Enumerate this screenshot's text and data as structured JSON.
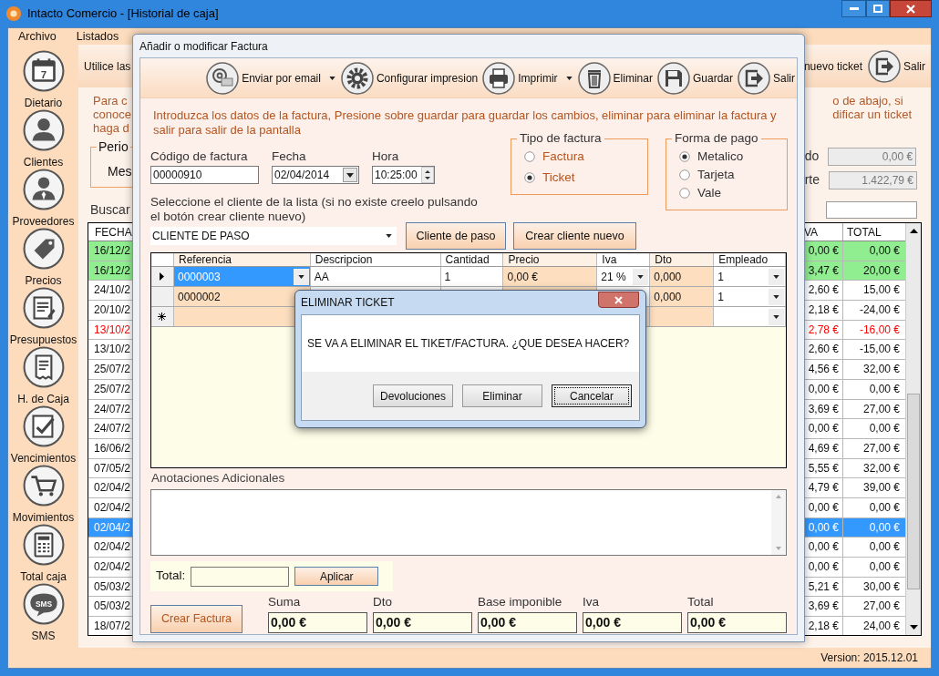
{
  "window": {
    "title": "Intacto Comercio - [Historial de caja]"
  },
  "menu": [
    "Archivo",
    "Listados"
  ],
  "sidebar": {
    "items": [
      {
        "label": "Dietario",
        "icon_text": "7"
      },
      {
        "label": "Clientes"
      },
      {
        "label": "Proveedores"
      },
      {
        "label": "Precios"
      },
      {
        "label": "Presupuestos"
      },
      {
        "label": "H. de Caja"
      },
      {
        "label": "Vencimientos"
      },
      {
        "label": "Movimientos"
      },
      {
        "label": "Total caja"
      },
      {
        "label": "SMS",
        "icon_text": "SMS"
      }
    ]
  },
  "main": {
    "hint": "Utilice las",
    "toolbar": [
      {
        "label": "nuevo ticket"
      },
      {
        "label": "Salir"
      }
    ],
    "help_left": [
      "Para c",
      "conoce",
      "haga d"
    ],
    "help_right": [
      "o de abajo, si",
      "dificar un ticket"
    ],
    "periodo": {
      "legend": "Perio",
      "value": "Mes"
    },
    "totals": [
      {
        "label": "do",
        "value": "0,00 €"
      },
      {
        "label": "rte",
        "value": "1.422,79 €"
      }
    ],
    "search_label": "Buscar",
    "table": {
      "columns": [
        "FECHA",
        "VA",
        "TOTAL"
      ],
      "rows": [
        {
          "fecha": "16/12/2",
          "iva": "0,00 €",
          "total": "0,00 €",
          "highlighted": true,
          "flagged": false,
          "selected": false
        },
        {
          "fecha": "16/12/2",
          "iva": "3,47 €",
          "total": "20,00 €",
          "highlighted": true,
          "flagged": false,
          "selected": false
        },
        {
          "fecha": "24/10/2",
          "iva": "2,60 €",
          "total": "15,00 €",
          "highlighted": false,
          "flagged": false,
          "selected": false
        },
        {
          "fecha": "20/10/2",
          "iva": "2,18 €",
          "total": "-24,00 €",
          "highlighted": false,
          "flagged": false,
          "selected": false
        },
        {
          "fecha": "13/10/2",
          "iva": "2,78 €",
          "total": "-16,00 €",
          "highlighted": false,
          "flagged": true,
          "selected": false
        },
        {
          "fecha": "13/10/2",
          "iva": "2,60 €",
          "total": "-15,00 €",
          "highlighted": false,
          "flagged": false,
          "selected": false
        },
        {
          "fecha": "25/07/2",
          "iva": "4,56 €",
          "total": "32,00 €",
          "highlighted": false,
          "flagged": false,
          "selected": false
        },
        {
          "fecha": "25/07/2",
          "iva": "0,00 €",
          "total": "0,00 €",
          "highlighted": false,
          "flagged": false,
          "selected": false
        },
        {
          "fecha": "24/07/2",
          "iva": "3,69 €",
          "total": "27,00 €",
          "highlighted": false,
          "flagged": false,
          "selected": false
        },
        {
          "fecha": "24/07/2",
          "iva": "0,00 €",
          "total": "0,00 €",
          "highlighted": false,
          "flagged": false,
          "selected": false
        },
        {
          "fecha": "16/06/2",
          "iva": "4,69 €",
          "total": "27,00 €",
          "highlighted": false,
          "flagged": false,
          "selected": false
        },
        {
          "fecha": "07/05/2",
          "iva": "5,55 €",
          "total": "32,00 €",
          "highlighted": false,
          "flagged": false,
          "selected": false
        },
        {
          "fecha": "02/04/2",
          "iva": "4,79 €",
          "total": "39,00 €",
          "highlighted": false,
          "flagged": false,
          "selected": false
        },
        {
          "fecha": "02/04/2",
          "iva": "0,00 €",
          "total": "0,00 €",
          "highlighted": false,
          "flagged": false,
          "selected": false
        },
        {
          "fecha": "02/04/2",
          "iva": "0,00 €",
          "total": "0,00 €",
          "highlighted": false,
          "flagged": false,
          "selected": true
        },
        {
          "fecha": "02/04/2",
          "iva": "0,00 €",
          "total": "0,00 €",
          "highlighted": false,
          "flagged": false,
          "selected": false
        },
        {
          "fecha": "02/04/2",
          "iva": "0,00 €",
          "total": "0,00 €",
          "highlighted": false,
          "flagged": false,
          "selected": false
        },
        {
          "fecha": "05/03/2",
          "iva": "5,21 €",
          "total": "30,00 €",
          "highlighted": false,
          "flagged": false,
          "selected": false
        },
        {
          "fecha": "05/03/2",
          "iva": "3,69 €",
          "total": "27,00 €",
          "highlighted": false,
          "flagged": false,
          "selected": false
        },
        {
          "fecha": "18/07/2",
          "iva": "2,18 €",
          "total": "24,00 €",
          "highlighted": false,
          "flagged": false,
          "selected": false
        }
      ]
    }
  },
  "status_bar": "Version: 2015.12.01",
  "dialog": {
    "title": "Añadir o modificar Factura",
    "toolbar": [
      {
        "label": "Enviar por email",
        "dropdown": true
      },
      {
        "label": "Configurar impresion",
        "dropdown": false
      },
      {
        "label": "Imprimir",
        "dropdown": true
      },
      {
        "label": "Eliminar",
        "dropdown": false
      },
      {
        "label": "Guardar",
        "dropdown": false
      },
      {
        "label": "Salir",
        "dropdown": false
      }
    ],
    "instructions": "Introduzca los datos de la factura, Presione sobre guardar para guardar los cambios, eliminar para eliminar la factura y salir para salir de la pantalla",
    "fields": [
      {
        "kind": "text",
        "label": "Código de factura",
        "value": "00000910"
      },
      {
        "kind": "date",
        "label": "Fecha",
        "value": "02/04/2014"
      },
      {
        "kind": "time",
        "label": "Hora",
        "value": "10:25:00"
      }
    ],
    "tipo_factura": {
      "legend": "Tipo de factura",
      "options": [
        {
          "label": "Factura",
          "selected": false
        },
        {
          "label": "Ticket",
          "selected": true
        }
      ]
    },
    "forma_pago": {
      "legend": "Forma de pago",
      "options": [
        {
          "label": "Metalico",
          "selected": true
        },
        {
          "label": "Tarjeta",
          "selected": false
        },
        {
          "label": "Vale",
          "selected": false
        }
      ]
    },
    "client_hint": "Seleccione el cliente de la lista (si no existe creelo pulsando el botón crear cliente nuevo)",
    "client": "CLIENTE DE PASO",
    "client_buttons": [
      "Cliente de paso",
      "Crear cliente nuevo"
    ],
    "grid": {
      "columns": [
        {
          "label": "Referencia",
          "shaded": true,
          "dropdown": true,
          "dropdown_always": false
        },
        {
          "label": "Descripcion",
          "shaded": false,
          "dropdown": false,
          "dropdown_always": false
        },
        {
          "label": "Cantidad",
          "shaded": false,
          "dropdown": false,
          "dropdown_always": false
        },
        {
          "label": "Precio",
          "shaded": true,
          "dropdown": false,
          "dropdown_always": false
        },
        {
          "label": "Iva",
          "shaded": false,
          "dropdown": true,
          "dropdown_always": false
        },
        {
          "label": "Dto",
          "shaded": true,
          "dropdown": false,
          "dropdown_always": false
        },
        {
          "label": "Empleado",
          "shaded": false,
          "dropdown": true,
          "dropdown_always": true
        }
      ],
      "rows": [
        {
          "kind": "item",
          "current": true,
          "cells": [
            "0000003",
            "AA",
            "1",
            "0,00 €",
            "21 %",
            "0,000",
            "1"
          ]
        },
        {
          "kind": "item",
          "current": false,
          "cells": [
            "0000002",
            null,
            null,
            null,
            null,
            "0,000",
            "1"
          ]
        },
        {
          "kind": "new",
          "current": false,
          "cells": [
            null,
            null,
            null,
            null,
            null,
            null,
            null
          ]
        }
      ]
    },
    "notes_label": "Anotaciones Adicionales",
    "total_entry": {
      "label": "Total:",
      "button": "Aplicar"
    },
    "create_button": "Crear Factura",
    "summary": [
      {
        "label": "Suma",
        "value": "0,00 €"
      },
      {
        "label": "Dto",
        "value": "0,00 €"
      },
      {
        "label": "Base imponible",
        "value": "0,00 €"
      },
      {
        "label": "Iva",
        "value": "0,00 €"
      },
      {
        "label": "Total",
        "value": "0,00 €"
      }
    ]
  },
  "message_box": {
    "title": "ELIMINAR TICKET",
    "message": "SE VA A ELIMINAR EL TIKET/FACTURA. ¿QUE DESEA HACER?",
    "buttons": [
      {
        "label": "Devoluciones",
        "focused": false
      },
      {
        "label": "Eliminar",
        "focused": false
      },
      {
        "label": "Cancelar",
        "focused": true
      }
    ]
  }
}
